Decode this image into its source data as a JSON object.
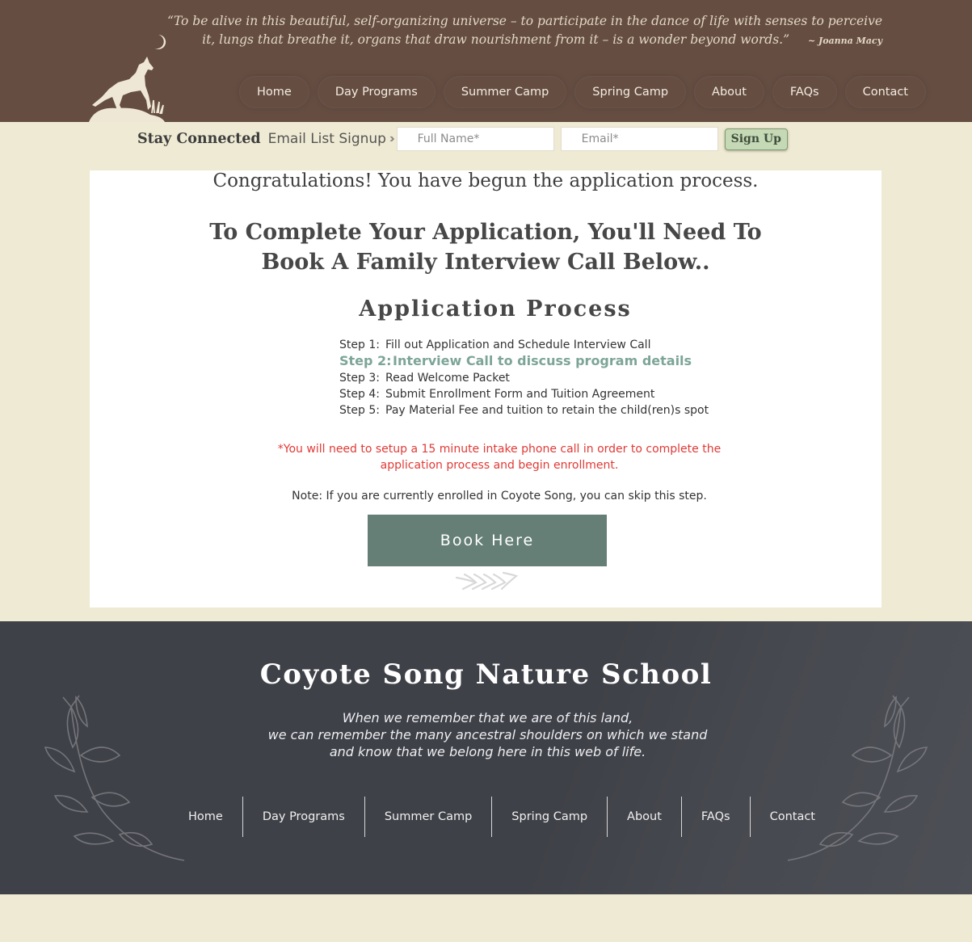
{
  "header": {
    "quote": "“To be alive in this beautiful, self-organizing universe – to participate in the dance of life with senses to perceive it, lungs that breathe it, organs that draw nourishment from it – is a wonder beyond words.”",
    "quote_author": "~ Joanna Macy",
    "nav": [
      "Home",
      "Day Programs",
      "Summer Camp",
      "Spring Camp",
      "About",
      "FAQs",
      "Contact"
    ]
  },
  "signup": {
    "stay_connected": "Stay Connected",
    "email_list": "Email List Signup",
    "name_placeholder": "Full Name*",
    "email_placeholder": "Email*",
    "button": "Sign Up"
  },
  "main": {
    "congrats": "Congratulations!  You have begun the application process.",
    "complete_line1": "To Complete Your Application, You'll Need To",
    "complete_line2": "Book A Family Interview Call Below..",
    "process_title": "Application Process",
    "steps": [
      {
        "num": "Step 1:",
        "text": "Fill out Application and Schedule Interview Call"
      },
      {
        "num": "Step 2:",
        "text": "Interview Call to discuss program details"
      },
      {
        "num": "Step 3:",
        "text": "Read Welcome Packet"
      },
      {
        "num": "Step 4:",
        "text": "Submit Enrollment Form and Tuition Agreement"
      },
      {
        "num": "Step 5:",
        "text": "Pay Material Fee and tuition to retain the child(ren)s spot"
      }
    ],
    "warning_line1": "*You will need to setup a 15 minute intake phone call in order to complete the",
    "warning_line2": "application process and begin enrollment.",
    "note": "Note: If you are currently enrolled in Coyote Song, you can skip this step.",
    "book_button": "Book Here"
  },
  "footer": {
    "title": "Coyote Song Nature School",
    "quote_line1": "When we remember that we are of this land,",
    "quote_line2": "we can remember the many ancestral shoulders on which we stand",
    "quote_line3": "and know that we belong here in this web of life.",
    "nav": [
      "Home",
      "Day Programs",
      "Summer Camp",
      "Spring Camp",
      "About",
      "FAQs",
      "Contact"
    ]
  },
  "colors": {
    "header_bg": "#654d42",
    "page_bg": "#efead3",
    "accent_green": "#657f76",
    "step_active": "#7da597",
    "warning_red": "#e03a36",
    "footer_bg": "#3f4148"
  },
  "icons": [
    "coyote-howling-logo",
    "moon-icon",
    "double-chevron-icon",
    "arrows-decoration-icon",
    "leaf-branch-decoration"
  ]
}
